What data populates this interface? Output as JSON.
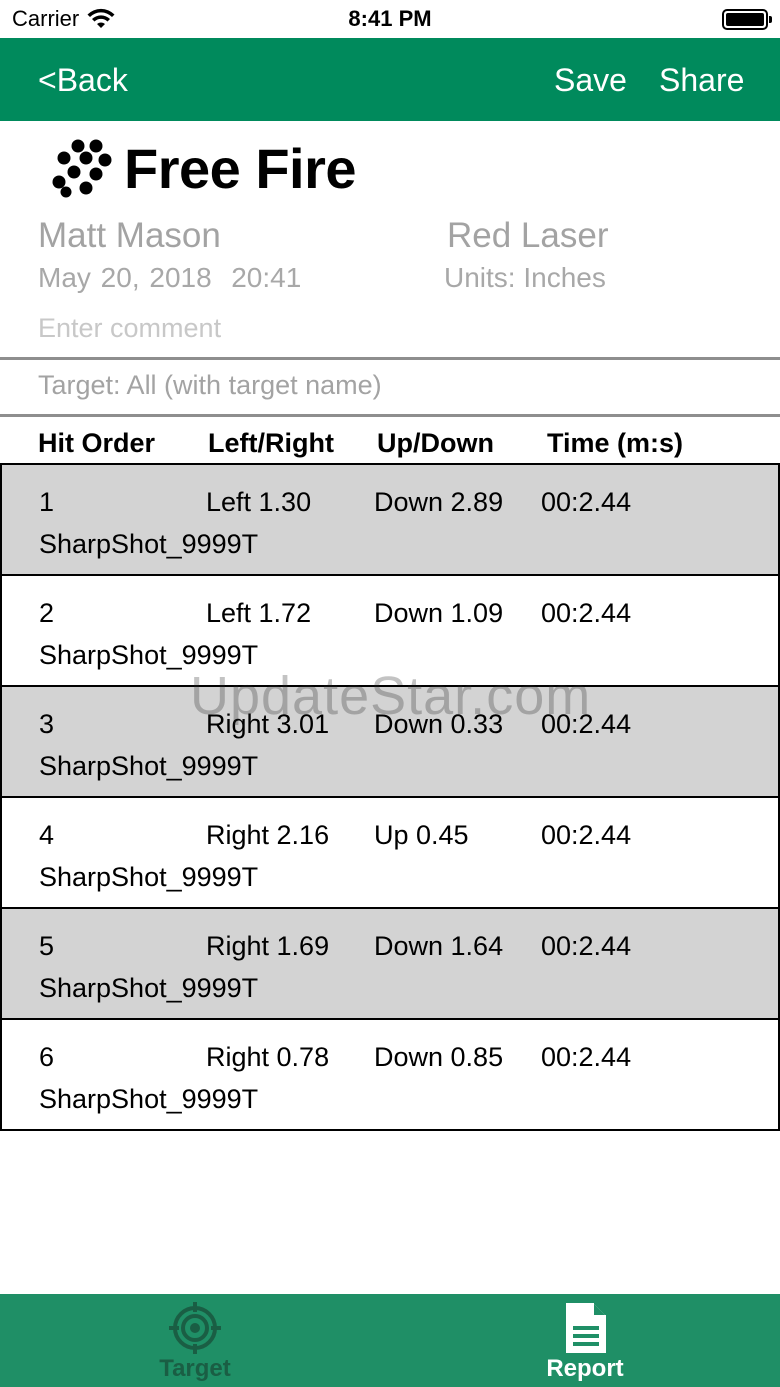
{
  "status_bar": {
    "carrier": "Carrier",
    "time": "8:41 PM"
  },
  "nav": {
    "back_label": "<Back",
    "save_label": "Save",
    "share_label": "Share"
  },
  "header": {
    "mode_title": "Free Fire",
    "mode_icon": "dots-cluster-icon",
    "shooter_name": "Matt Mason",
    "session_date": "May 20, 2018  20:41",
    "laser_type": "Red Laser",
    "units": "Units: Inches",
    "comment_placeholder": "Enter comment"
  },
  "filter": {
    "target_label": "Target: All (with target name)"
  },
  "table": {
    "columns": [
      "Hit Order",
      "Left/Right",
      "Up/Down",
      "Time (m:s)"
    ],
    "rows": [
      {
        "order": "1",
        "left_right": "Left 1.30",
        "up_down": "Down 2.89",
        "time": "00:2.44",
        "target": "SharpShot_9999T",
        "shaded": true
      },
      {
        "order": "2",
        "left_right": "Left 1.72",
        "up_down": "Down 1.09",
        "time": "00:2.44",
        "target": "SharpShot_9999T",
        "shaded": false
      },
      {
        "order": "3",
        "left_right": "Right 3.01",
        "up_down": "Down 0.33",
        "time": "00:2.44",
        "target": "SharpShot_9999T",
        "shaded": true
      },
      {
        "order": "4",
        "left_right": "Right 2.16",
        "up_down": "Up 0.45",
        "time": "00:2.44",
        "target": "SharpShot_9999T",
        "shaded": false
      },
      {
        "order": "5",
        "left_right": "Right 1.69",
        "up_down": "Down 1.64",
        "time": "00:2.44",
        "target": "SharpShot_9999T",
        "shaded": true
      },
      {
        "order": "6",
        "left_right": "Right 0.78",
        "up_down": "Down 0.85",
        "time": "00:2.44",
        "target": "SharpShot_9999T",
        "shaded": false
      }
    ]
  },
  "watermark": "UpdateStar.com",
  "tabs": [
    {
      "label": "Target",
      "icon": "crosshair-target-icon",
      "active": false
    },
    {
      "label": "Report",
      "icon": "document-report-icon",
      "active": true
    }
  ],
  "colors": {
    "nav_green": "#008a5c",
    "tab_green": "#1f8f66",
    "row_shade": "#d3d3d3",
    "muted_text": "#a3a3a3"
  }
}
